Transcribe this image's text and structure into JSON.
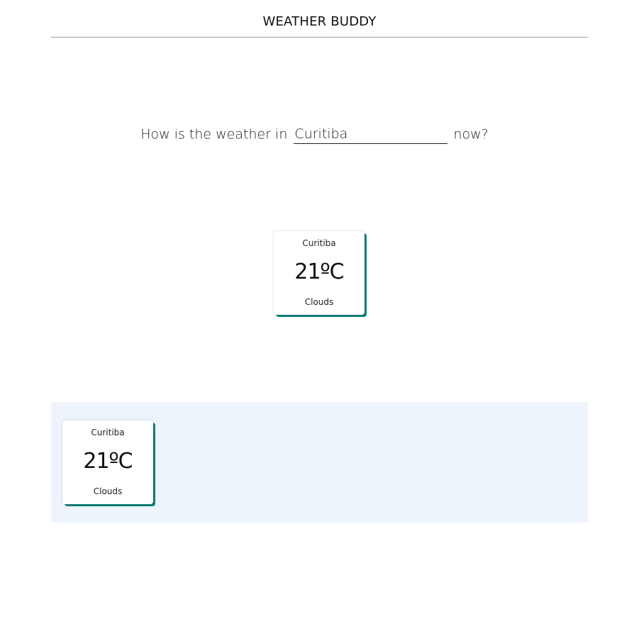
{
  "header": {
    "title": "WEATHER BUDDY"
  },
  "question": {
    "prefix": "How is the weather in",
    "input_value": "Curitiba",
    "suffix": "now?"
  },
  "current": {
    "city": "Curitiba",
    "temperature": "21ºC",
    "condition": "Clouds"
  },
  "history": [
    {
      "city": "Curitiba",
      "temperature": "21ºC",
      "condition": "Clouds"
    }
  ],
  "colors": {
    "card_accent": "#0f7a74",
    "history_background": "#eef4fc"
  }
}
